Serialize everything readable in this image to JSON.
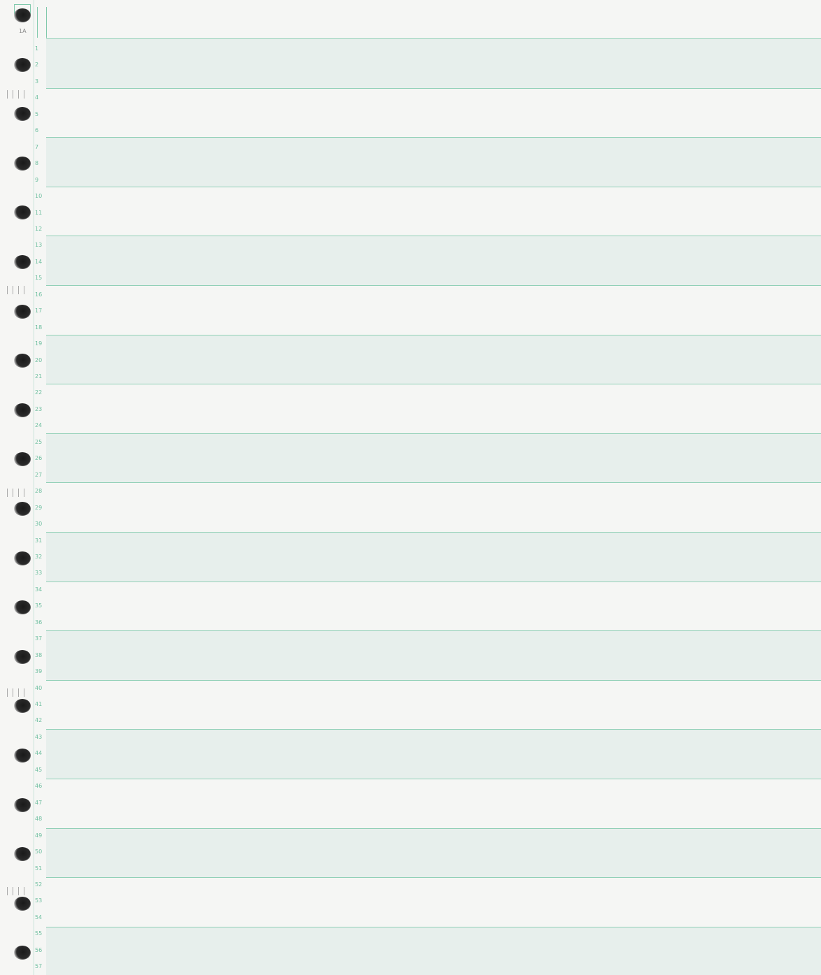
{
  "sheet": {
    "label": "1A",
    "line_numbers": [
      "1",
      "2",
      "3",
      "4",
      "5",
      "6",
      "7",
      "8",
      "9",
      "10",
      "11",
      "12",
      "13",
      "14",
      "15",
      "16",
      "17",
      "18",
      "19",
      "20",
      "21",
      "22",
      "23",
      "24",
      "25",
      "26",
      "27",
      "28",
      "29",
      "30",
      "31",
      "32",
      "33",
      "34",
      "35",
      "36",
      "37",
      "38",
      "39",
      "40",
      "41",
      "42",
      "43",
      "44",
      "45",
      "46",
      "47",
      "48",
      "49",
      "50",
      "51",
      "52",
      "53",
      "54",
      "55",
      "56",
      "57"
    ],
    "colors": {
      "band": "#e7efec",
      "paper": "#f5f6f4",
      "rule": "#7fc9ab",
      "numbers": "#6fbfa0"
    }
  }
}
